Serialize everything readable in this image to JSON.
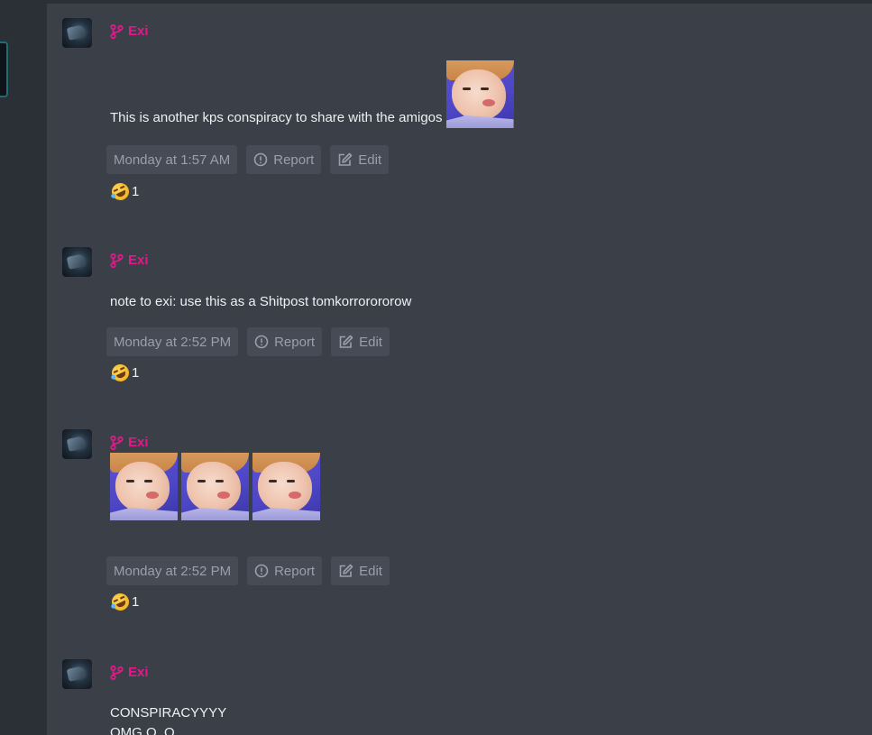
{
  "colors": {
    "background": "#2b2f36",
    "feed": "#3a3f48",
    "author": "#e8168a",
    "button_bg": "#464b55",
    "button_text": "#98a0ab",
    "text": "#eef0f3"
  },
  "messages": [
    {
      "author": "Exi",
      "text": "This is another kps conspiracy to share with the amigos",
      "timestamp": "Monday at 1:57 AM",
      "report_label": "Report",
      "edit_label": "Edit",
      "reaction_icon": "rolling-on-floor-laughing-emoji",
      "reaction_count": "1"
    },
    {
      "author": "Exi",
      "text": "note to exi: use this as a Shitpost tomkorrorororow",
      "timestamp": "Monday at 2:52 PM",
      "report_label": "Report",
      "edit_label": "Edit",
      "reaction_icon": "rolling-on-floor-laughing-emoji",
      "reaction_count": "1"
    },
    {
      "author": "Exi",
      "timestamp": "Monday at 2:52 PM",
      "report_label": "Report",
      "edit_label": "Edit",
      "reaction_icon": "rolling-on-floor-laughing-emoji",
      "reaction_count": "1"
    },
    {
      "author": "Exi",
      "text": "CONSPIRACYYYY\nOMG O_O\nI ALMOST FORGOTS"
    }
  ]
}
